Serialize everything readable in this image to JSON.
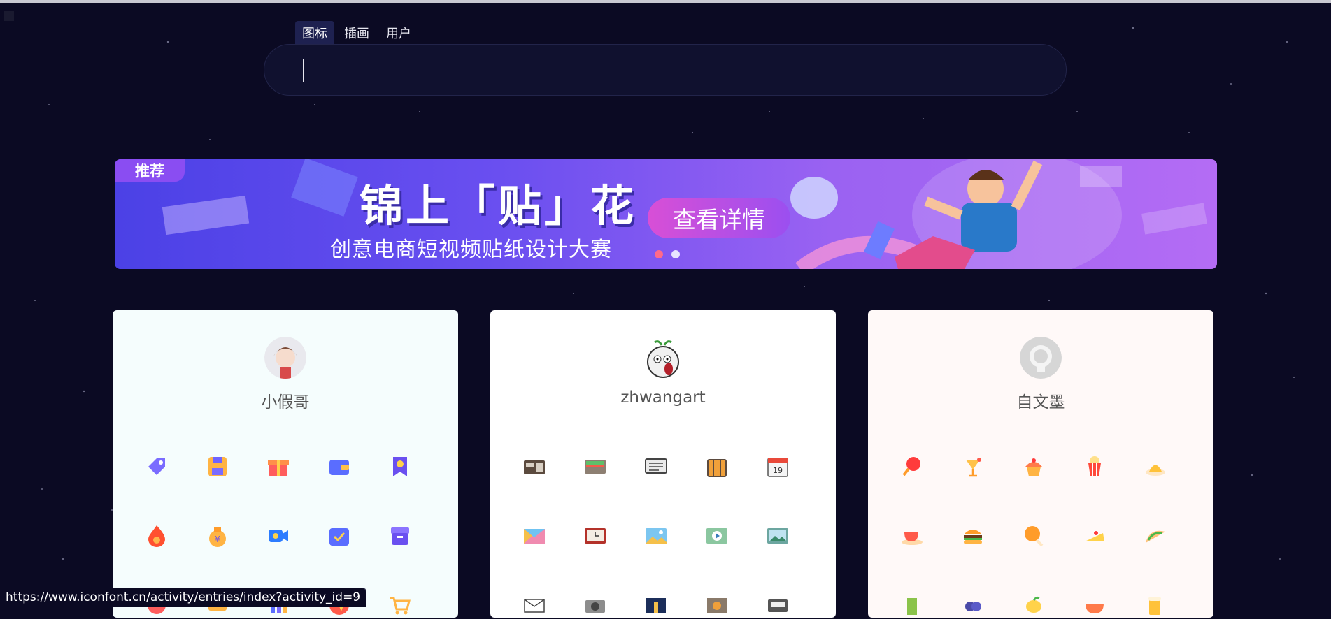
{
  "search": {
    "tabs": [
      {
        "label": "图标",
        "active": true
      },
      {
        "label": "插画",
        "active": false
      },
      {
        "label": "用户",
        "active": false
      }
    ],
    "value": ""
  },
  "banner": {
    "tag": "推荐",
    "title": "锦上「贴」花",
    "subtitle": "创意电商短视频贴纸设计大赛",
    "button_label": "查看详情",
    "slides": 2,
    "active_slide": 1
  },
  "cards": [
    {
      "name": "小假哥",
      "avatar": "cartoon-boy-avatar",
      "icons": [
        "tag-icon",
        "floppy-disk-icon",
        "gift-box-icon",
        "wallet-icon",
        "bookmark-star-icon",
        "fire-icon",
        "money-bag-icon",
        "video-camera-icon",
        "calendar-check-icon",
        "archive-box-icon",
        "badge-icon",
        "coupon-icon",
        "chart-icon",
        "paper-plane-icon",
        "shopping-cart-icon"
      ]
    },
    {
      "name": "zhwangart",
      "avatar": "screaming-egg-avatar",
      "icons": [
        "radio-icon",
        "wallet-card-icon",
        "chat-bubble-icon",
        "suitcase-icon",
        "calendar-icon",
        "envelope-color-icon",
        "clock-icon",
        "landscape-photo-icon",
        "play-frame-icon",
        "image-frame-icon",
        "mail-icon",
        "camera-icon",
        "night-city-icon",
        "safe-icon",
        "cassette-icon"
      ]
    },
    {
      "name": "自文墨",
      "avatar": "default-user-avatar",
      "icons": [
        "lollipop-icon",
        "cocktail-icon",
        "cupcake-icon",
        "popcorn-icon",
        "pudding-icon",
        "teacup-icon",
        "burger-icon",
        "chicken-leg-icon",
        "cake-slice-icon",
        "taco-icon",
        "drink-cup-icon",
        "blueberry-icon",
        "lemon-icon",
        "noodle-bowl-icon",
        "beer-icon"
      ]
    }
  ],
  "status_bar": {
    "url": "https://www.iconfont.cn/activity/entries/index?activity_id=9"
  },
  "colors": {
    "background": "#0b0a23",
    "banner_start": "#4b41e6",
    "banner_end": "#b46cf4",
    "card_text": "#555555"
  }
}
